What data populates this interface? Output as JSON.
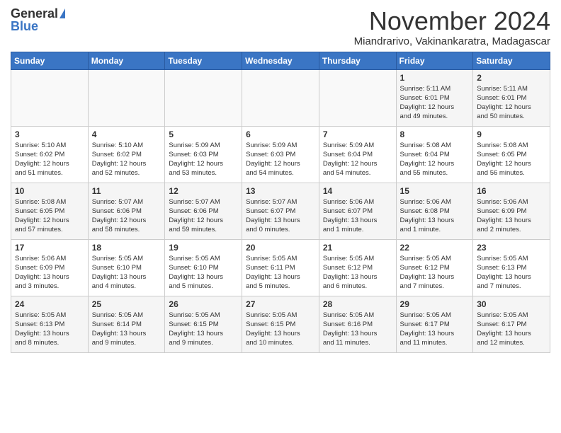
{
  "logo": {
    "general": "General",
    "blue": "Blue"
  },
  "title": {
    "month_year": "November 2024",
    "location": "Miandrarivo, Vakinankaratra, Madagascar"
  },
  "days_of_week": [
    "Sunday",
    "Monday",
    "Tuesday",
    "Wednesday",
    "Thursday",
    "Friday",
    "Saturday"
  ],
  "weeks": [
    [
      {
        "day": "",
        "info": ""
      },
      {
        "day": "",
        "info": ""
      },
      {
        "day": "",
        "info": ""
      },
      {
        "day": "",
        "info": ""
      },
      {
        "day": "",
        "info": ""
      },
      {
        "day": "1",
        "info": "Sunrise: 5:11 AM\nSunset: 6:01 PM\nDaylight: 12 hours\nand 49 minutes."
      },
      {
        "day": "2",
        "info": "Sunrise: 5:11 AM\nSunset: 6:01 PM\nDaylight: 12 hours\nand 50 minutes."
      }
    ],
    [
      {
        "day": "3",
        "info": "Sunrise: 5:10 AM\nSunset: 6:02 PM\nDaylight: 12 hours\nand 51 minutes."
      },
      {
        "day": "4",
        "info": "Sunrise: 5:10 AM\nSunset: 6:02 PM\nDaylight: 12 hours\nand 52 minutes."
      },
      {
        "day": "5",
        "info": "Sunrise: 5:09 AM\nSunset: 6:03 PM\nDaylight: 12 hours\nand 53 minutes."
      },
      {
        "day": "6",
        "info": "Sunrise: 5:09 AM\nSunset: 6:03 PM\nDaylight: 12 hours\nand 54 minutes."
      },
      {
        "day": "7",
        "info": "Sunrise: 5:09 AM\nSunset: 6:04 PM\nDaylight: 12 hours\nand 54 minutes."
      },
      {
        "day": "8",
        "info": "Sunrise: 5:08 AM\nSunset: 6:04 PM\nDaylight: 12 hours\nand 55 minutes."
      },
      {
        "day": "9",
        "info": "Sunrise: 5:08 AM\nSunset: 6:05 PM\nDaylight: 12 hours\nand 56 minutes."
      }
    ],
    [
      {
        "day": "10",
        "info": "Sunrise: 5:08 AM\nSunset: 6:05 PM\nDaylight: 12 hours\nand 57 minutes."
      },
      {
        "day": "11",
        "info": "Sunrise: 5:07 AM\nSunset: 6:06 PM\nDaylight: 12 hours\nand 58 minutes."
      },
      {
        "day": "12",
        "info": "Sunrise: 5:07 AM\nSunset: 6:06 PM\nDaylight: 12 hours\nand 59 minutes."
      },
      {
        "day": "13",
        "info": "Sunrise: 5:07 AM\nSunset: 6:07 PM\nDaylight: 13 hours\nand 0 minutes."
      },
      {
        "day": "14",
        "info": "Sunrise: 5:06 AM\nSunset: 6:07 PM\nDaylight: 13 hours\nand 1 minute."
      },
      {
        "day": "15",
        "info": "Sunrise: 5:06 AM\nSunset: 6:08 PM\nDaylight: 13 hours\nand 1 minute."
      },
      {
        "day": "16",
        "info": "Sunrise: 5:06 AM\nSunset: 6:09 PM\nDaylight: 13 hours\nand 2 minutes."
      }
    ],
    [
      {
        "day": "17",
        "info": "Sunrise: 5:06 AM\nSunset: 6:09 PM\nDaylight: 13 hours\nand 3 minutes."
      },
      {
        "day": "18",
        "info": "Sunrise: 5:05 AM\nSunset: 6:10 PM\nDaylight: 13 hours\nand 4 minutes."
      },
      {
        "day": "19",
        "info": "Sunrise: 5:05 AM\nSunset: 6:10 PM\nDaylight: 13 hours\nand 5 minutes."
      },
      {
        "day": "20",
        "info": "Sunrise: 5:05 AM\nSunset: 6:11 PM\nDaylight: 13 hours\nand 5 minutes."
      },
      {
        "day": "21",
        "info": "Sunrise: 5:05 AM\nSunset: 6:12 PM\nDaylight: 13 hours\nand 6 minutes."
      },
      {
        "day": "22",
        "info": "Sunrise: 5:05 AM\nSunset: 6:12 PM\nDaylight: 13 hours\nand 7 minutes."
      },
      {
        "day": "23",
        "info": "Sunrise: 5:05 AM\nSunset: 6:13 PM\nDaylight: 13 hours\nand 7 minutes."
      }
    ],
    [
      {
        "day": "24",
        "info": "Sunrise: 5:05 AM\nSunset: 6:13 PM\nDaylight: 13 hours\nand 8 minutes."
      },
      {
        "day": "25",
        "info": "Sunrise: 5:05 AM\nSunset: 6:14 PM\nDaylight: 13 hours\nand 9 minutes."
      },
      {
        "day": "26",
        "info": "Sunrise: 5:05 AM\nSunset: 6:15 PM\nDaylight: 13 hours\nand 9 minutes."
      },
      {
        "day": "27",
        "info": "Sunrise: 5:05 AM\nSunset: 6:15 PM\nDaylight: 13 hours\nand 10 minutes."
      },
      {
        "day": "28",
        "info": "Sunrise: 5:05 AM\nSunset: 6:16 PM\nDaylight: 13 hours\nand 11 minutes."
      },
      {
        "day": "29",
        "info": "Sunrise: 5:05 AM\nSunset: 6:17 PM\nDaylight: 13 hours\nand 11 minutes."
      },
      {
        "day": "30",
        "info": "Sunrise: 5:05 AM\nSunset: 6:17 PM\nDaylight: 13 hours\nand 12 minutes."
      }
    ]
  ]
}
